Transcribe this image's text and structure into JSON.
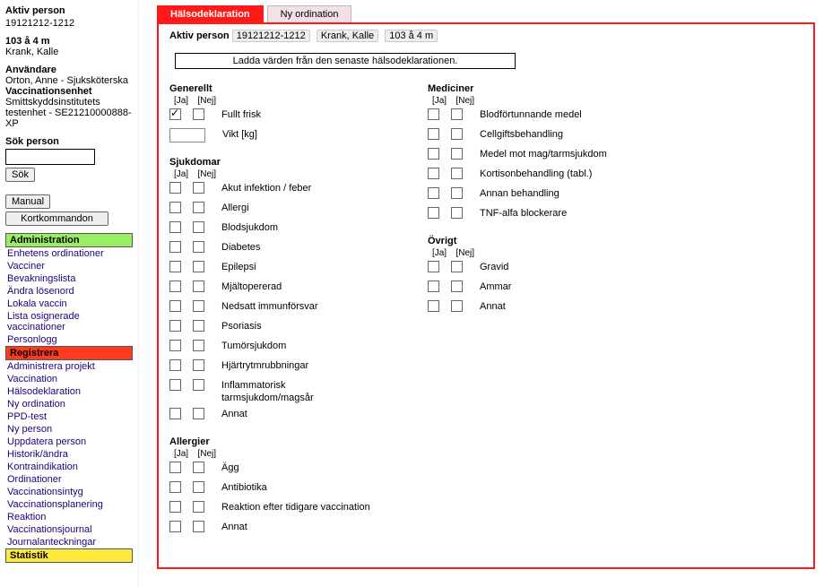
{
  "sidebar": {
    "aktiv_label": "Aktiv person",
    "aktiv_id": "19121212-1212",
    "age": "103 å 4 m",
    "name": "Krank, Kalle",
    "user_label": "Användare",
    "user_name": "Orton, Anne - Sjuksköterska",
    "unit_label": "Vaccinationsenhet",
    "unit_line1": "Smittskyddsinstitutets testenhet - SE21210000888-XP",
    "search_label": "Sök person",
    "search_placeholder": "",
    "search_value": "",
    "search_btn": "Sök",
    "manual_btn": "Manual",
    "kort_btn": "Kortkommandon",
    "nav": {
      "admin_header": "Administration",
      "admin_items": [
        "Enhetens ordinationer",
        "Vacciner",
        "Bevakningslista",
        "Ändra lösenord",
        "Lokala vaccin",
        "Lista osignerade vaccinationer",
        "Personlogg"
      ],
      "reg_header": "Registrera",
      "reg_items": [
        "Administrera projekt",
        "Vaccination",
        "Hälsodeklaration",
        "Ny ordination",
        "PPD-test",
        "Ny person",
        "Uppdatera person",
        "Historik/ändra",
        "Kontraindikation",
        "Ordinationer",
        "Vaccinationsintyg",
        "Vaccinationsplanering",
        "Reaktion",
        "Vaccinationsjournal",
        "Journalanteckningar"
      ],
      "stat_header": "Statistik"
    }
  },
  "tabs": {
    "t0": "Hälsodeklaration",
    "t1": "Ny ordination"
  },
  "active_bar": {
    "label": "Aktiv person",
    "id": "19121212-1212",
    "name": "Krank, Kalle",
    "age": "103 å 4 m"
  },
  "load_button": "Ladda värden från den senaste hälsodeklarationen.",
  "labels": {
    "ja": "[Ja]",
    "nej": "[Nej]"
  },
  "sections": {
    "generellt": {
      "title": "Generellt",
      "fullt_frisk": "Fullt frisk",
      "fullt_ja_checked": true,
      "vikt": "Vikt [kg]",
      "vikt_value": ""
    },
    "sjukdomar": {
      "title": "Sjukdomar",
      "items": [
        "Akut infektion / feber",
        "Allergi",
        "Blodsjukdom",
        "Diabetes",
        "Epilepsi",
        "Mjältopererad",
        "Nedsatt immunförsvar",
        "Psoriasis",
        "Tumörsjukdom",
        "Hjärtrytmrubbningar",
        "Inflammatorisk tarmsjukdom/magsår",
        "Annat"
      ]
    },
    "allergier": {
      "title": "Allergier",
      "items": [
        "Ägg",
        "Antibiotika",
        "Reaktion efter tidigare vaccination",
        "Annat"
      ]
    },
    "mediciner": {
      "title": "Mediciner",
      "items": [
        "Blodförtunnande medel",
        "Cellgiftsbehandling",
        "Medel mot mag/tarmsjukdom",
        "Kortisonbehandling (tabl.)",
        "Annan behandling",
        "TNF-alfa blockerare"
      ]
    },
    "ovrigt": {
      "title": "Övrigt",
      "items": [
        "Gravid",
        "Ammar",
        "Annat"
      ]
    }
  }
}
